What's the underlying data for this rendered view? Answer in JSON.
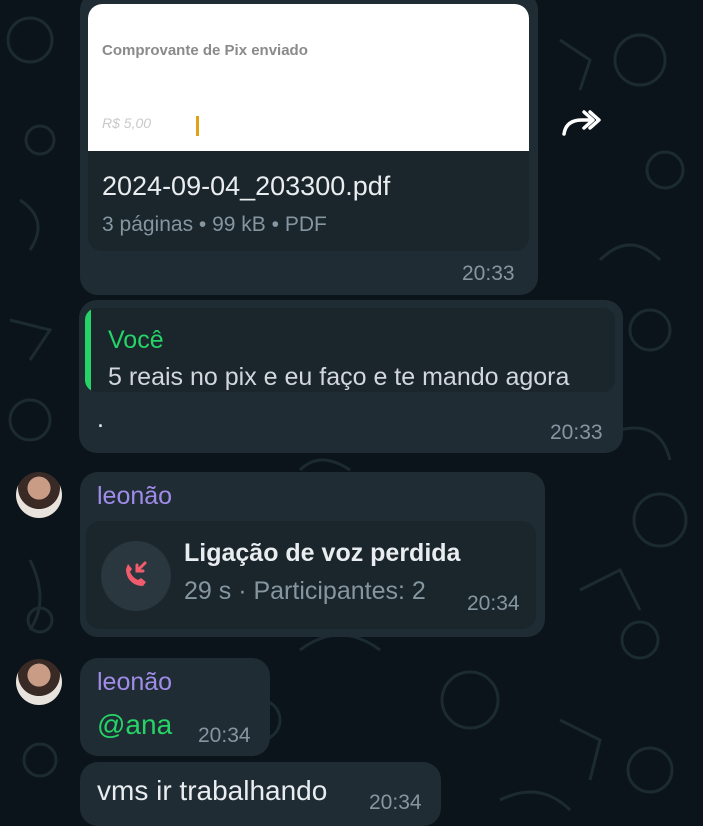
{
  "messages": {
    "pdf": {
      "preview_title": "Comprovante de Pix enviado",
      "preview_snippet": "R$ 5,00",
      "filename": "2024-09-04_203300.pdf",
      "meta": "3 páginas • 99 kB • PDF",
      "time": "20:33",
      "forward_icon": "forward-icon"
    },
    "reply": {
      "quoted_author": "Você",
      "quoted_text": "5 reais no pix e eu faço e te mando agora",
      "body": ".",
      "time": "20:33"
    },
    "call": {
      "sender": "leonão",
      "title": "Ligação de voz perdida",
      "detail": "29 s · Participantes: 2",
      "time": "20:34",
      "icon": "missed-call-icon"
    },
    "mention": {
      "sender": "leonão",
      "text": "@ana",
      "time": "20:34"
    },
    "last": {
      "text": "vms ir trabalhando",
      "time": "20:34"
    }
  },
  "colors": {
    "background": "#0b141a",
    "bubble": "#1f2c34",
    "inner": "#1a252c",
    "accent_green": "#25d366",
    "sender_purple": "#a08ce8",
    "missed_red": "#f15c6d"
  }
}
